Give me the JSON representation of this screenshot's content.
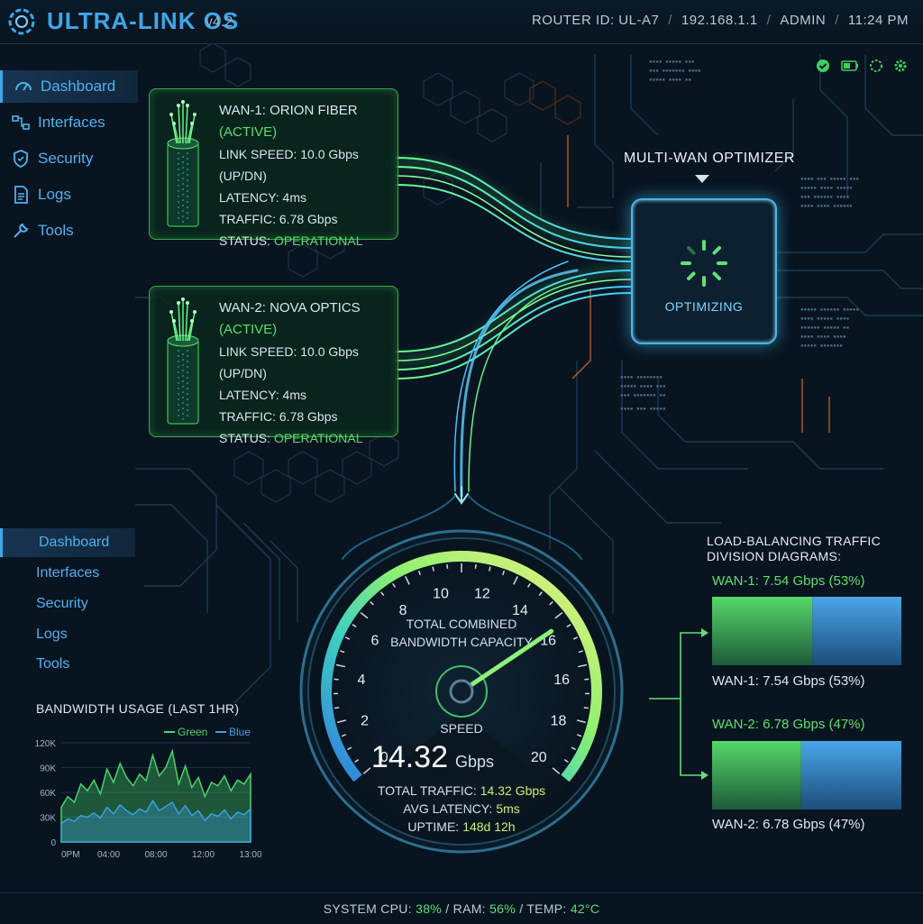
{
  "header": {
    "title": "ULTRA-LINK OS",
    "version": "v4.2",
    "router_id": "ROUTER ID: UL-A7",
    "ip": "192.168.1.1",
    "user": "ADMIN",
    "time": "11:24 PM",
    "separator": "/"
  },
  "tray_icons": [
    "check-circle-icon",
    "battery-icon",
    "loading-icon",
    "gear-icon"
  ],
  "sidebar": {
    "items": [
      {
        "label": "Dashboard",
        "icon": "gauge-icon",
        "active": true
      },
      {
        "label": "Interfaces",
        "icon": "network-icon"
      },
      {
        "label": "Security",
        "icon": "shield-icon"
      },
      {
        "label": "Logs",
        "icon": "document-icon"
      },
      {
        "label": "Tools",
        "icon": "wrench-icon"
      }
    ],
    "items_secondary": [
      {
        "label": "Dashboard",
        "active": true
      },
      {
        "label": "Interfaces"
      },
      {
        "label": "Security"
      },
      {
        "label": "Logs"
      },
      {
        "label": "Tools"
      }
    ]
  },
  "wan1": {
    "name": "WAN-1: ORION FIBER",
    "state": "(ACTIVE)",
    "link_speed_label": "LINK SPEED:",
    "link_speed": "10.0 Gbps (UP/DN)",
    "latency_label": "LATENCY:",
    "latency": "4ms",
    "traffic_label": "TRAFFIC:",
    "traffic": "6.78 Gbps",
    "status_label": "STATUS:",
    "status": "OPERATIONAL"
  },
  "wan2": {
    "name": "WAN-2: NOVA OPTICS",
    "state": "(ACTIVE)",
    "link_speed_label": "LINK SPEED:",
    "link_speed": "10.0 Gbps (UP/DN)",
    "latency_label": "LATENCY:",
    "latency": "4ms",
    "traffic_label": "TRAFFIC:",
    "traffic": "6.78 Gbps",
    "status_label": "STATUS:",
    "status": "OPERATIONAL"
  },
  "optimizer": {
    "title": "MULTI-WAN OPTIMIZER",
    "status": "OPTIMIZING"
  },
  "gauge": {
    "title_line1": "TOTAL COMBINED",
    "title_line2": "BANDWIDTH CAPACITY",
    "ticks": [
      "0",
      "2",
      "4",
      "6",
      "8",
      "10",
      "12",
      "14",
      "16",
      "16",
      "18",
      "20"
    ],
    "speed_label": "SPEED",
    "speed_value": "14.32",
    "speed_unit": "Gbps",
    "needle_value": 14.32,
    "max": 20,
    "total_traffic_label": "TOTAL TRAFFIC:",
    "total_traffic": "14.32 Gbps",
    "avg_latency_label": "AVG LATENCY:",
    "avg_latency": "5ms",
    "uptime_label": "UPTIME:",
    "uptime": "148d 12h"
  },
  "load_balance": {
    "title_line1": "LOAD-BALANCING TRAFFIC",
    "title_line2": "DIVISION DIAGRAMS:",
    "wan1_label": "WAN-1: 7.54 Gbps (53%)",
    "wan1_share": 0.53,
    "wan2_label": "WAN-2: 6.78 Gbps (47%)",
    "wan2_share": 0.47
  },
  "chart_data": {
    "type": "area",
    "title": "BANDWIDTH USAGE (LAST 1HR)",
    "xlabel": "",
    "ylabel": "",
    "x_ticks": [
      "0PM",
      "04:00",
      "08:00",
      "12:00",
      "13:00"
    ],
    "y_ticks": [
      "0",
      "30K",
      "60K",
      "90K",
      "120K"
    ],
    "ylim": [
      0,
      120000
    ],
    "legend_position": "top-right",
    "grid": true,
    "series": [
      {
        "name": "Green",
        "color": "#49d36a",
        "values": [
          42000,
          55000,
          48000,
          70000,
          62000,
          75000,
          58000,
          88000,
          72000,
          95000,
          78000,
          68000,
          82000,
          74000,
          105000,
          80000,
          90000,
          110000,
          70000,
          92000,
          66000,
          78000,
          55000,
          72000,
          68000,
          80000,
          62000,
          75000,
          70000,
          82000
        ]
      },
      {
        "name": "Blue",
        "color": "#3c9fe0",
        "values": [
          22000,
          28000,
          25000,
          32000,
          30000,
          35000,
          29000,
          42000,
          34000,
          45000,
          38000,
          33000,
          40000,
          36000,
          50000,
          38000,
          43000,
          48000,
          34000,
          44000,
          32000,
          38000,
          26000,
          34000,
          31000,
          39000,
          28000,
          36000,
          33000,
          40000
        ]
      }
    ]
  },
  "footer": {
    "cpu_label": "SYSTEM CPU:",
    "cpu": "38%",
    "ram_label": "RAM:",
    "ram": "56%",
    "temp_label": "TEMP:",
    "temp": "42°C",
    "sep": "/"
  }
}
